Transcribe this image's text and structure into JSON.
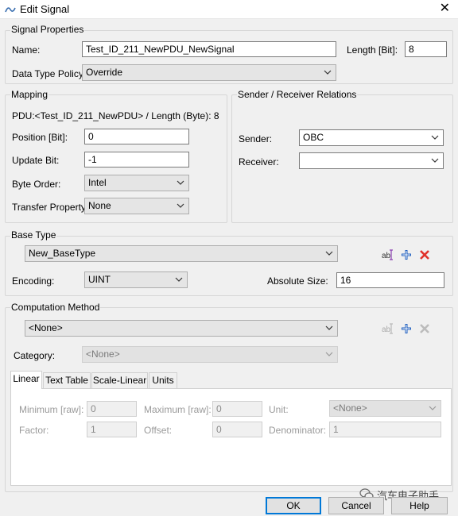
{
  "window": {
    "title": "Edit Signal",
    "close_glyph": "✕"
  },
  "signal_properties": {
    "group_label": "Signal Properties",
    "name_label": "Name:",
    "name_value": "Test_ID_211_NewPDU_NewSignal",
    "length_label": "Length [Bit]:",
    "length_value": "8",
    "dtp_label": "Data Type Policy:",
    "dtp_value": "Override"
  },
  "mapping": {
    "group_label": "Mapping",
    "pdu_text": "PDU:<Test_ID_211_NewPDU> / Length (Byte): 8",
    "position_label": "Position [Bit]:",
    "position_value": "0",
    "update_label": "Update Bit:",
    "update_value": "-1",
    "byte_order_label": "Byte Order:",
    "byte_order_value": "Intel",
    "transfer_label": "Transfer Property:",
    "transfer_value": "None"
  },
  "sender_receiver": {
    "group_label": "Sender / Receiver Relations",
    "sender_label": "Sender:",
    "sender_value": "OBC",
    "receiver_label": "Receiver:",
    "receiver_value": ""
  },
  "base_type": {
    "group_label": "Base Type",
    "value": "New_BaseType",
    "encoding_label": "Encoding:",
    "encoding_value": "UINT",
    "abs_size_label": "Absolute Size:",
    "abs_size_value": "16"
  },
  "computation": {
    "group_label": "Computation Method",
    "value": "<None>",
    "category_label": "Category:",
    "category_value": "<None>",
    "tabs": [
      "Linear",
      "Text Table",
      "Scale-Linear",
      "Units"
    ],
    "active_tab": "Linear",
    "linear": {
      "min_label": "Minimum [raw]:",
      "min_value": "0",
      "max_label": "Maximum [raw]:",
      "max_value": "0",
      "unit_label": "Unit:",
      "unit_value": "<None>",
      "factor_label": "Factor:",
      "factor_value": "1",
      "offset_label": "Offset:",
      "offset_value": "0",
      "denominator_label": "Denominator:",
      "denominator_value": "1"
    }
  },
  "buttons": {
    "ok": "OK",
    "cancel": "Cancel",
    "help": "Help"
  },
  "watermark": "汽车电子助手",
  "colors": {
    "accent": "#0078d7",
    "add_icon": "#1f5fbf",
    "delete_icon": "#e0312a"
  },
  "icons": [
    "rename-icon",
    "add-icon",
    "delete-icon",
    "chevron-down-icon",
    "wechat-logo"
  ]
}
